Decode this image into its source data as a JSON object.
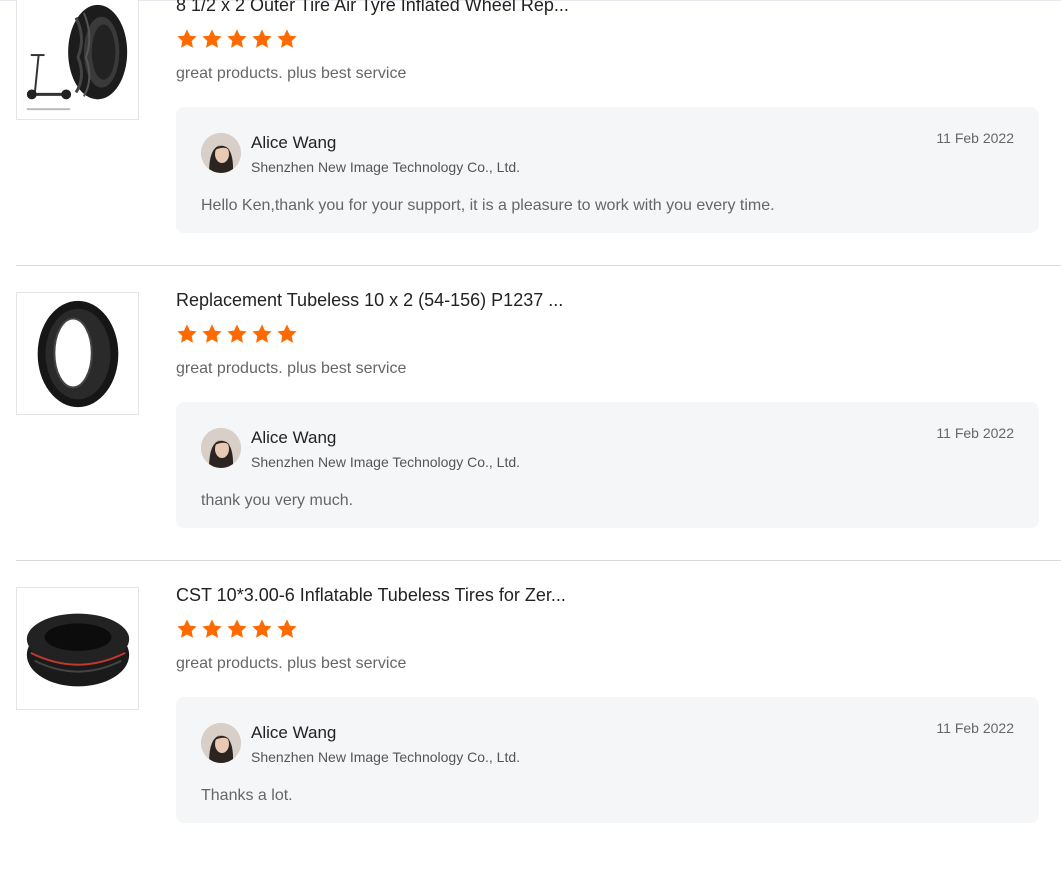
{
  "reviews": [
    {
      "product_title": "8 1/2 x 2 Outer Tire Air Tyre Inflated Wheel Rep...",
      "rating": 5,
      "comment": "great products.  plus best service",
      "reply": {
        "name": "Alice Wang",
        "company": "Shenzhen New Image Technology Co., Ltd.",
        "date": "11 Feb 2022",
        "text": "Hello Ken,thank you for your support, it is a pleasure to work with you every time."
      }
    },
    {
      "product_title": "Replacement Tubeless 10 x 2 (54-156) P1237 ...",
      "rating": 5,
      "comment": "great products.  plus best service",
      "reply": {
        "name": "Alice Wang",
        "company": "Shenzhen New Image Technology Co., Ltd.",
        "date": "11 Feb 2022",
        "text": "thank you very much."
      }
    },
    {
      "product_title": "CST 10*3.00-6 Inflatable Tubeless Tires for Zer...",
      "rating": 5,
      "comment": "great products.  plus best service",
      "reply": {
        "name": "Alice Wang",
        "company": "Shenzhen New Image Technology Co., Ltd.",
        "date": "11 Feb 2022",
        "text": "Thanks a lot."
      }
    }
  ],
  "colors": {
    "star": "#ff6a00",
    "reply_bg": "#f5f6f8"
  },
  "icons": {
    "star": "star-icon",
    "avatar": "avatar",
    "product_image": "tire-image"
  }
}
